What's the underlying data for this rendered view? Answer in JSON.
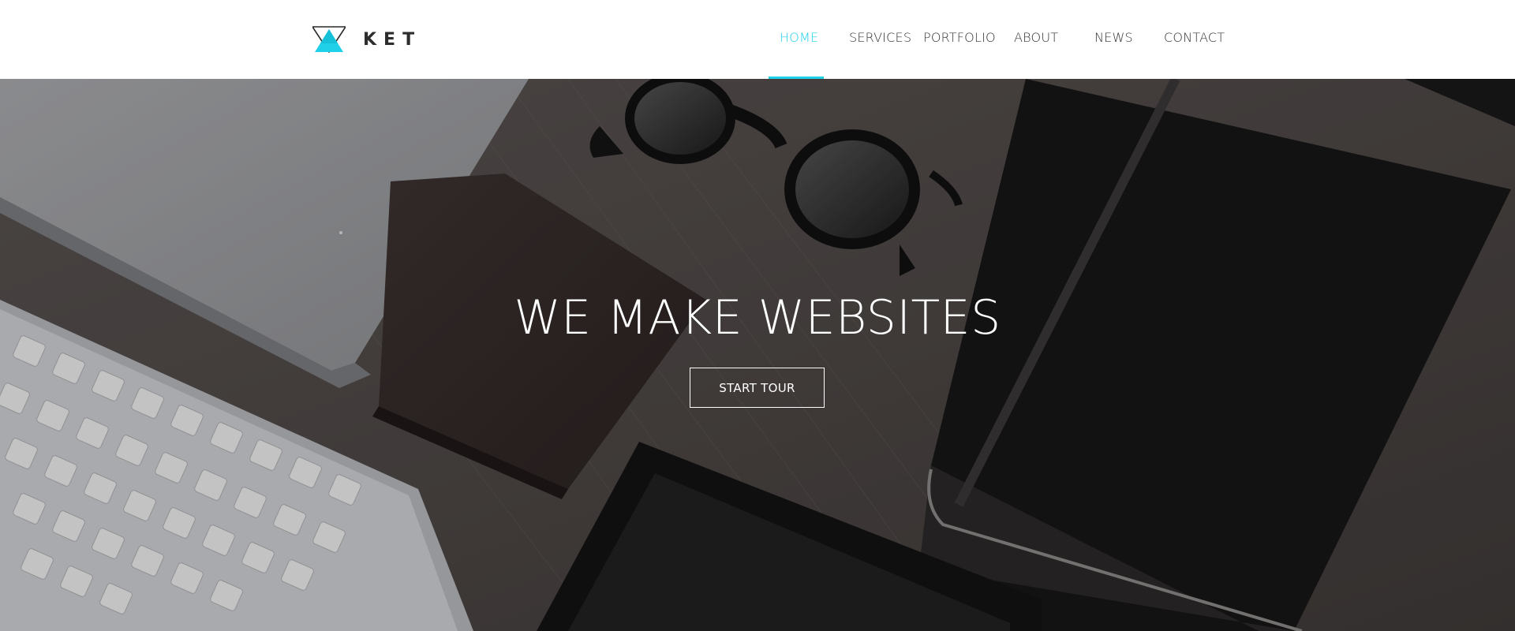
{
  "brand": {
    "name": "KET",
    "logo_icon": "triangle-logo-icon",
    "accent_color": "#1fd0e8"
  },
  "nav": {
    "items": [
      {
        "label": "HOME",
        "active": true
      },
      {
        "label": "SERVICES",
        "active": false
      },
      {
        "label": "PORTFOLIO",
        "active": false
      },
      {
        "label": "ABOUT",
        "active": false
      },
      {
        "label": "NEWS",
        "active": false
      },
      {
        "label": "CONTACT",
        "active": false
      }
    ]
  },
  "hero": {
    "title": "WE MAKE WEBSITES",
    "button_label": "START TOUR",
    "background": "desk-photo-laptop-keyboard-wallet-sunglasses-notebook-tablet"
  }
}
